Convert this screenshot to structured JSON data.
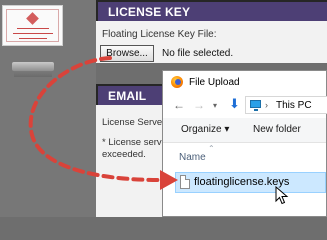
{
  "license_panel": {
    "title": "LICENSE KEY",
    "field_label": "Floating License Key File:",
    "browse_label": "Browse...",
    "file_status": "No file selected."
  },
  "email_panel": {
    "title": "EMAIL",
    "line1": "License Server",
    "line2": "* License serve",
    "line3": "exceeded."
  },
  "dialog": {
    "title": "File Upload",
    "breadcrumb": "This PC",
    "organize_label": "Organize ▾",
    "new_folder_label": "New folder",
    "column_header": "Name",
    "file_name": "floatinglicense.keys"
  },
  "colors": {
    "header_purple": "#4d3f75",
    "annotation_red": "#d9433a",
    "selection_blue": "#cce8ff"
  },
  "icons": {
    "back": "←",
    "forward": "→",
    "up": "↑",
    "chevron": "›",
    "down_arrow": "⬇",
    "sort_caret": "⌃"
  }
}
